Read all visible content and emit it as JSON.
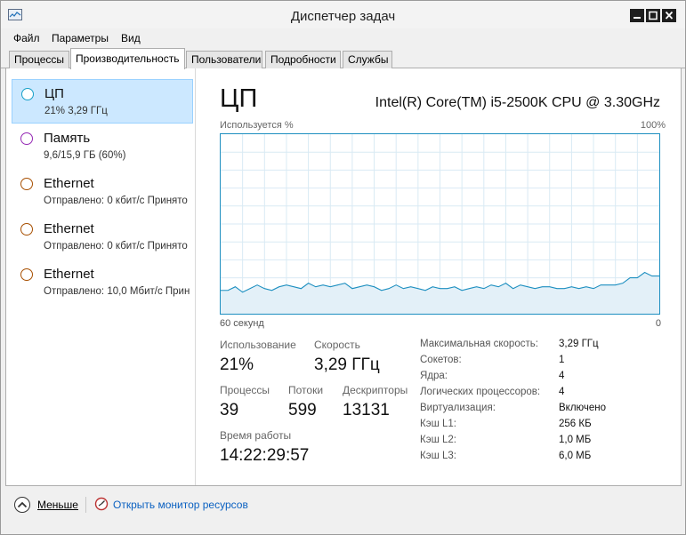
{
  "window": {
    "title": "Диспетчер задач"
  },
  "menubar": {
    "items": [
      "Файл",
      "Параметры",
      "Вид"
    ]
  },
  "tabs": [
    "Процессы",
    "Производительность",
    "Пользователи",
    "Подробности",
    "Службы"
  ],
  "active_tab": "Производительность",
  "sidebar": {
    "items": [
      {
        "name": "ЦП",
        "sub": "21% 3,29 ГГц",
        "color": "#17a0c8",
        "selected": true
      },
      {
        "name": "Память",
        "sub": "9,6/15,9 ГБ (60%)",
        "color": "#9528b4",
        "selected": false
      },
      {
        "name": "Ethernet",
        "sub": "Отправлено: 0 кбит/с Принято",
        "color": "#a74f01",
        "selected": false
      },
      {
        "name": "Ethernet",
        "sub": "Отправлено: 0 кбит/с Принято",
        "color": "#a74f01",
        "selected": false
      },
      {
        "name": "Ethernet",
        "sub": "Отправлено: 10,0 Мбит/с Прин",
        "color": "#a74f01",
        "selected": false
      }
    ]
  },
  "cpu": {
    "title": "ЦП",
    "model": "Intel(R) Core(TM) i5-2500K CPU @ 3.30GHz",
    "graph": {
      "top_left": "Используется %",
      "top_right": "100%",
      "bottom_left": "60 секунд",
      "bottom_right": "0"
    },
    "stats": {
      "usage_label": "Использование",
      "usage_value": "21%",
      "speed_label": "Скорость",
      "speed_value": "3,29 ГГц",
      "processes_label": "Процессы",
      "processes_value": "39",
      "threads_label": "Потоки",
      "threads_value": "599",
      "handles_label": "Дескрипторы",
      "handles_value": "13131",
      "uptime_label": "Время работы",
      "uptime_value": "14:22:29:57"
    },
    "specs": [
      {
        "label": "Максимальная скорость:",
        "value": "3,29 ГГц"
      },
      {
        "label": "Сокетов:",
        "value": "1"
      },
      {
        "label": "Ядра:",
        "value": "4"
      },
      {
        "label": "Логических процессоров:",
        "value": "4"
      },
      {
        "label": "Виртуализация:",
        "value": "Включено"
      },
      {
        "label": "Кэш L1:",
        "value": "256 КБ"
      },
      {
        "label": "Кэш L2:",
        "value": "1,0 МБ"
      },
      {
        "label": "Кэш L3:",
        "value": "6,0 МБ"
      }
    ]
  },
  "chart_data": {
    "type": "area",
    "x": [
      60,
      59,
      58,
      57,
      56,
      55,
      54,
      53,
      52,
      51,
      50,
      49,
      48,
      47,
      46,
      45,
      44,
      43,
      42,
      41,
      40,
      39,
      38,
      37,
      36,
      35,
      34,
      33,
      32,
      31,
      30,
      29,
      28,
      27,
      26,
      25,
      24,
      23,
      22,
      21,
      20,
      19,
      18,
      17,
      16,
      15,
      14,
      13,
      12,
      11,
      10,
      9,
      8,
      7,
      6,
      5,
      4,
      3,
      2,
      1,
      0
    ],
    "values": [
      13,
      13,
      15,
      12,
      14,
      16,
      14,
      13,
      15,
      16,
      15,
      14,
      17,
      15,
      16,
      15,
      16,
      17,
      14,
      15,
      16,
      15,
      13,
      14,
      16,
      14,
      15,
      14,
      13,
      15,
      14,
      14,
      15,
      13,
      14,
      15,
      14,
      16,
      15,
      17,
      14,
      16,
      15,
      14,
      15,
      15,
      14,
      14,
      15,
      14,
      15,
      14,
      16,
      16,
      16,
      17,
      20,
      20,
      23,
      21,
      21
    ],
    "ylim": [
      0,
      100
    ],
    "xlim": [
      60,
      0
    ],
    "color": "#1d8fc0",
    "grid": true
  },
  "footer": {
    "less_label": "Меньше",
    "monitor_link": "Открыть монитор ресурсов"
  }
}
